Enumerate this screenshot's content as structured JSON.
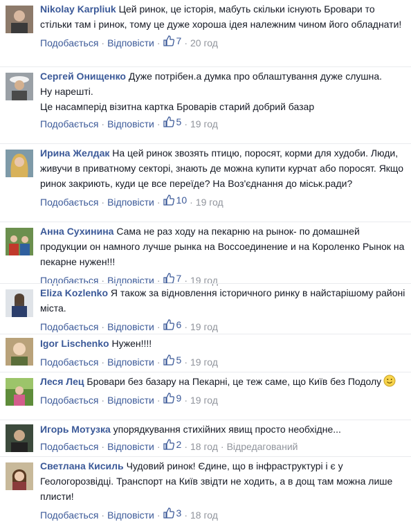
{
  "actions": {
    "like": "Подобається",
    "reply": "Відповісти",
    "separator": "·",
    "edited": "Відредагований"
  },
  "comments": [
    {
      "author": "Nikolay Karpliuk",
      "text": "Цей ринок, це історія, мабуть скільки існують Бровари то стільки там і ринок, тому це дуже хороша ідея належним чином його обладнати!",
      "likes": "7",
      "time": "20 год"
    },
    {
      "author": "Сергей Онищенко",
      "text": "Дуже потрібен.а думка про облаштування дуже слушна.",
      "text2": "Ну нарешті.",
      "text3": "Це насамперід візитна картка Броварів старий добрий базар",
      "likes": "5",
      "time": "19 год"
    },
    {
      "author": "Ирина Желдак",
      "text": "На цей ринок звозять птицю, поросят, корми для худоби. Люди, живучи в приватному секторі, знають де можна купити курчат або поросят. Якщо ринок закриють, куди це все переїде? На Воз'єднання до міськ.ради?",
      "likes": "10",
      "time": "19 год"
    },
    {
      "author": "Анна Сухинина",
      "text": "Сама не раз ходу на пекарню на рынок- по домашней продукции он намного лучше рынка на Воссоединение и на Короленко Рынок на пекарне нужен!!!",
      "likes": "7",
      "time": "19 год"
    },
    {
      "author": "Eliza Kozlenko",
      "text": "Я також за відновлення історичного ринку в найстарішому районі міста.",
      "likes": "6",
      "time": "19 год"
    },
    {
      "author": "Igor Lischenko",
      "text": "Нужен!!!!",
      "likes": "5",
      "time": "19 год"
    },
    {
      "author": "Леся Лец",
      "text": "Бровари без базару на Пекарні, це теж саме, що Київ без Подолу",
      "likes": "9",
      "time": "19 год"
    },
    {
      "author": "Игорь Мотузка",
      "text": "упорядкування стихійних явищ просто необхідне...",
      "likes": "2",
      "time": "18 год"
    },
    {
      "author": "Светлана Кисиль",
      "text": "Чудовий ринок! Єдине, що в інфраструктурі і є у Геологорозвідці. Транспорт на Київ звідти не ходить, а в дощ там можна лише плисти!",
      "likes": "3",
      "time": "18 год"
    }
  ]
}
